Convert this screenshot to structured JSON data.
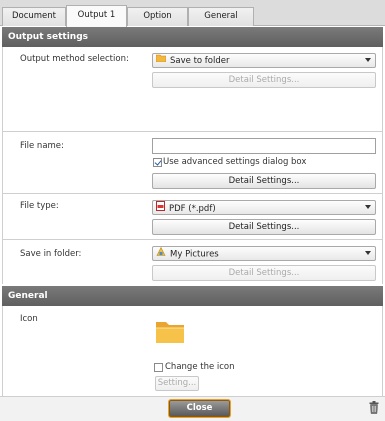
{
  "tabs": [
    {
      "label": "Document"
    },
    {
      "label": "Output 1"
    },
    {
      "label": "Option"
    },
    {
      "label": "General"
    }
  ],
  "output_settings": {
    "header": "Output settings",
    "method_label": "Output method selection:",
    "method_value": "Save to folder",
    "method_detail": "Detail Settings...",
    "file_name_label": "File name:",
    "file_name_value": "",
    "advanced_checkbox_label": "Use advanced settings dialog box",
    "advanced_checked": true,
    "file_name_detail": "Detail Settings...",
    "file_type_label": "File type:",
    "file_type_value": "PDF (*.pdf)",
    "file_type_detail": "Detail Settings...",
    "save_folder_label": "Save in folder:",
    "save_folder_value": "My Pictures",
    "save_folder_detail": "Detail Settings..."
  },
  "general": {
    "header": "General",
    "icon_label": "Icon",
    "change_icon_label": "Change the icon",
    "change_icon_checked": false,
    "setting_button": "Setting..."
  },
  "footer": {
    "close_label": "Close"
  },
  "colors": {
    "section_header": "#666666",
    "folder_icon": "#f3b63f",
    "close_focus": "#e6a22b"
  }
}
